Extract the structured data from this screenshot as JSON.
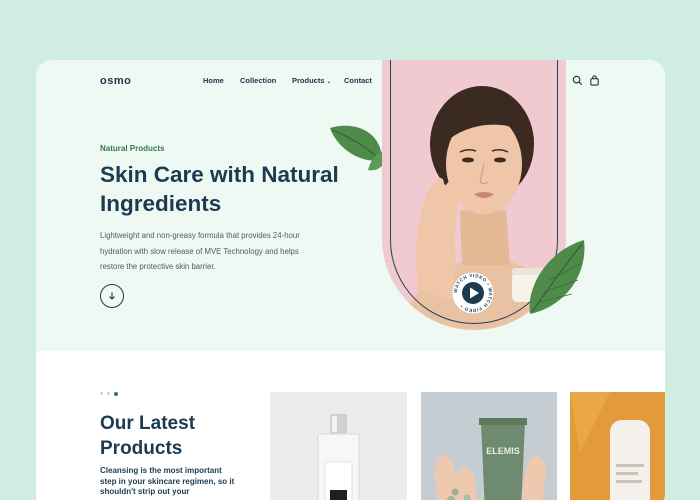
{
  "brand": {
    "logo": "osmo"
  },
  "nav": {
    "links": [
      {
        "label": "Home"
      },
      {
        "label": "Collection"
      },
      {
        "label": "Products",
        "has_dropdown": true
      },
      {
        "label": "Contact"
      }
    ],
    "icons": [
      "search-icon",
      "shopping-bag-icon"
    ]
  },
  "hero": {
    "eyebrow": "Natural Products",
    "headline": "Skin Care with Natural Ingredients",
    "description": "Lightweight and non-greasy formula that provides 24-hour hydration with slow release of MVE Technology and helps restore the protective skin barrier.",
    "scroll_icon": "arrow-down-icon",
    "video_badge_text": "WATCH VIDEO • WATCH VIDEO •"
  },
  "latest": {
    "title": "Our Latest Products",
    "description": "Cleansing is the most important step in your skincare regimen, so it shouldn't strip out your",
    "carousel_dots": 3,
    "active_dot": 2,
    "product_labels": [
      "ELEMIS"
    ]
  },
  "colors": {
    "page_bg": "#cfeee1",
    "hero_bg": "#eef9f3",
    "accent_green": "#2f7a55",
    "navy": "#1d3b50",
    "arch_pink": "#f1c9d0"
  }
}
